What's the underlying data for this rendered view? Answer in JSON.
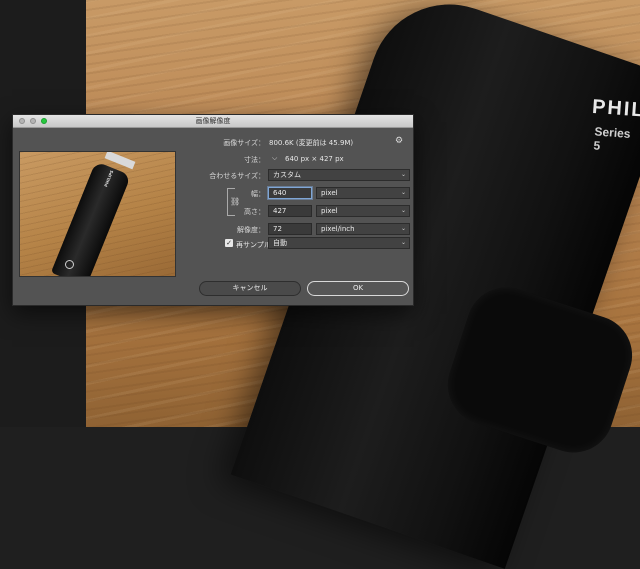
{
  "background": {
    "brand": "PHILI",
    "series": "Series 5"
  },
  "dialog": {
    "title": "画像解像度",
    "image_size_label": "画像サイズ：",
    "image_size_value": "800.6K (変更前は 45.9M)",
    "dimensions_label": "寸法：",
    "dimensions_value": "640 px × 427 px",
    "fit_label": "合わせるサイズ：",
    "fit_value": "カスタム",
    "width_label": "幅：",
    "width_value": "640",
    "width_unit": "pixel",
    "height_label": "高さ：",
    "height_value": "427",
    "height_unit": "pixel",
    "resolution_label": "解像度：",
    "resolution_value": "72",
    "resolution_unit": "pixel/inch",
    "resample_label": "再サンプル：",
    "resample_value": "自動",
    "resample_checked": true,
    "cancel_label": "キャンセル",
    "ok_label": "OK",
    "preview_brand": "PHILIPS"
  },
  "icons": {
    "gear": "gear-icon",
    "chain": "chain-link-icon",
    "chevron": "chevron-down-icon",
    "check": "checkmark-icon"
  },
  "colors": {
    "dialog_bg": "#535353",
    "focus_ring": "#7fa6d6",
    "traffic_green": "#27c93f"
  }
}
